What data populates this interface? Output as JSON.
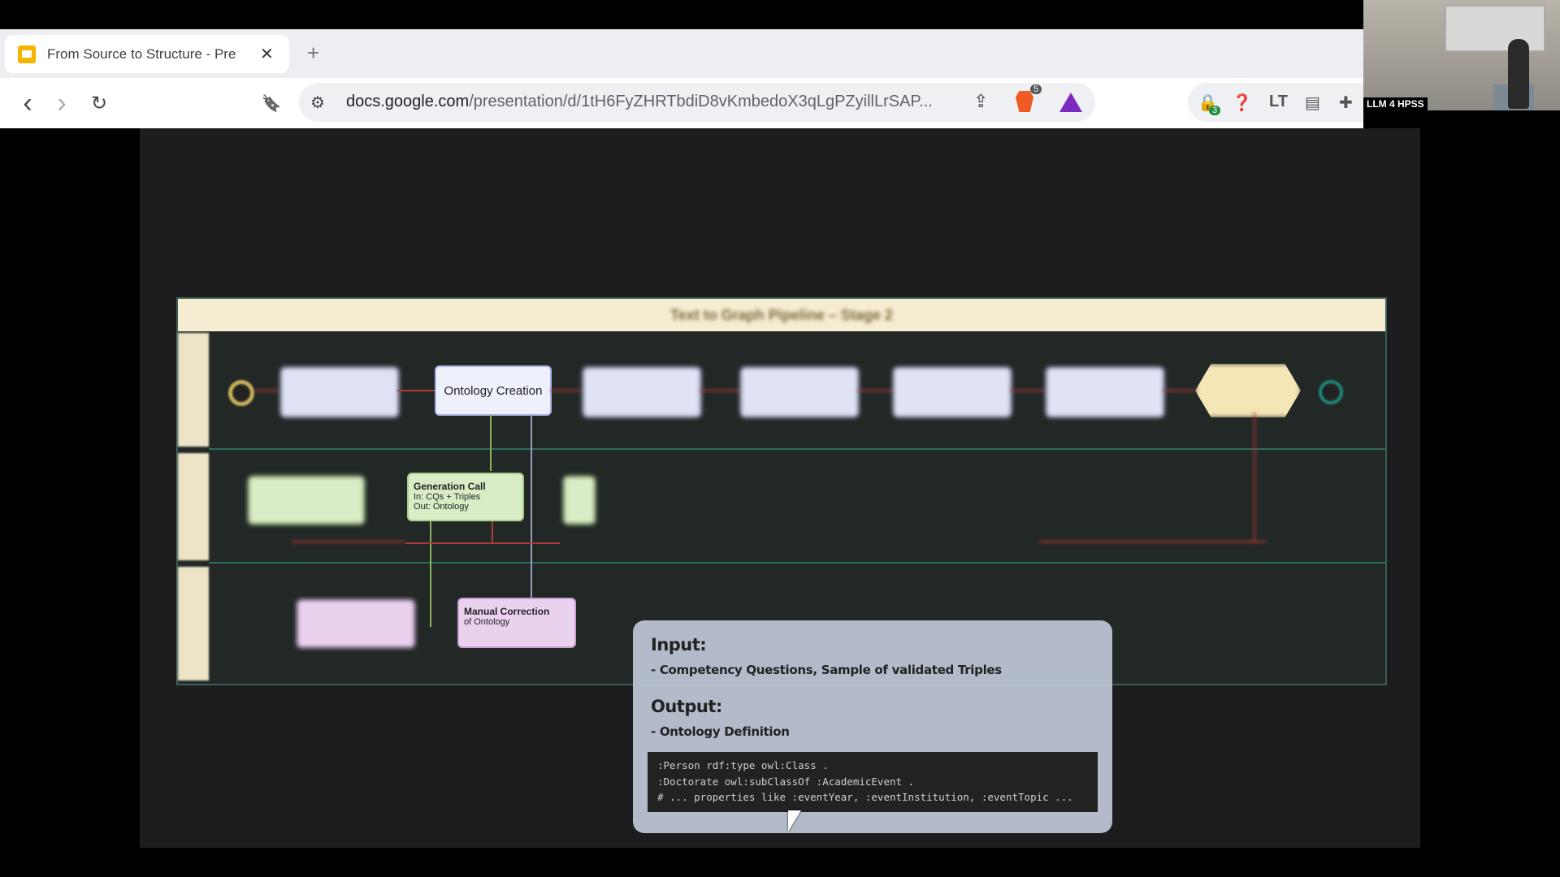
{
  "browser": {
    "tab": {
      "title": "From Source to Structure - Pre",
      "close": "✕"
    },
    "new_tab": "+",
    "nav": {
      "back": "‹",
      "forward": "›",
      "reload": "↻",
      "bookmark": "🔖"
    },
    "omnibox": {
      "host": "docs.google.com",
      "path": "/presentation/d/1tH6FyZHRTbdiD8vKmbedoX3qLgPZyillLrSAP..."
    },
    "badges": {
      "brave": "5",
      "extension": "3"
    }
  },
  "video": {
    "label": "LLM 4 HPSS"
  },
  "diagram": {
    "title": "Text to Graph Pipeline – Stage 2",
    "nodes": {
      "ontology_creation": "Ontology Creation",
      "generation_call_title": "Generation Call",
      "generation_call_in": "In: CQs + Triples",
      "generation_call_out": "Out: Ontology",
      "manual_correction_title": "Manual Correction",
      "manual_correction_sub": "of Ontology"
    }
  },
  "popup": {
    "input_heading": "Input:",
    "input_text": "- Competency Questions, Sample of validated Triples",
    "output_heading": "Output:",
    "output_text": "- Ontology Definition",
    "code_lines": [
      ":Person rdf:type owl:Class .",
      ":Doctorate owl:subClassOf :AcademicEvent .",
      "# ... properties like :eventYear, :eventInstitution, :eventTopic ..."
    ]
  },
  "colors": {
    "slide_bg": "#1d1d1f",
    "diagram_header": "#f6ecd2",
    "popup_bg": "#bec6d7",
    "brave": "#f15a22"
  }
}
